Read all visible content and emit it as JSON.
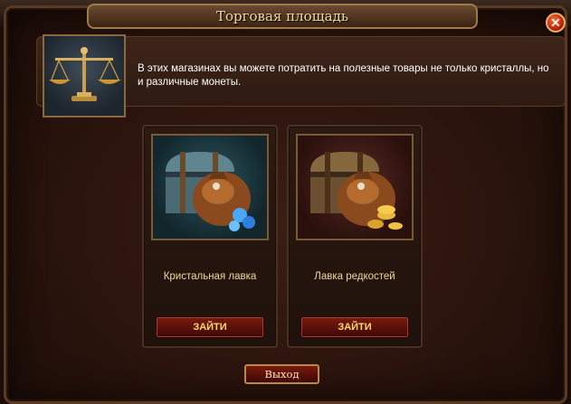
{
  "window": {
    "title": "Торговая площадь"
  },
  "info": {
    "text": "В этих магазинах вы можете потратить на полезные товары не только кристаллы, но и различные монеты.",
    "icon": "scales-icon"
  },
  "shops": [
    {
      "label": "Кристальная лавка",
      "button": "ЗАЙТИ",
      "icon": "crystal-chest-icon"
    },
    {
      "label": "Лавка редкостей",
      "button": "ЗАЙТИ",
      "icon": "coin-chest-icon"
    }
  ],
  "footer": {
    "exit_label": "Выход"
  },
  "colors": {
    "accent_gold": "#f1d79a",
    "button_red": "#7a1a0e",
    "close_red": "#d0300f"
  }
}
